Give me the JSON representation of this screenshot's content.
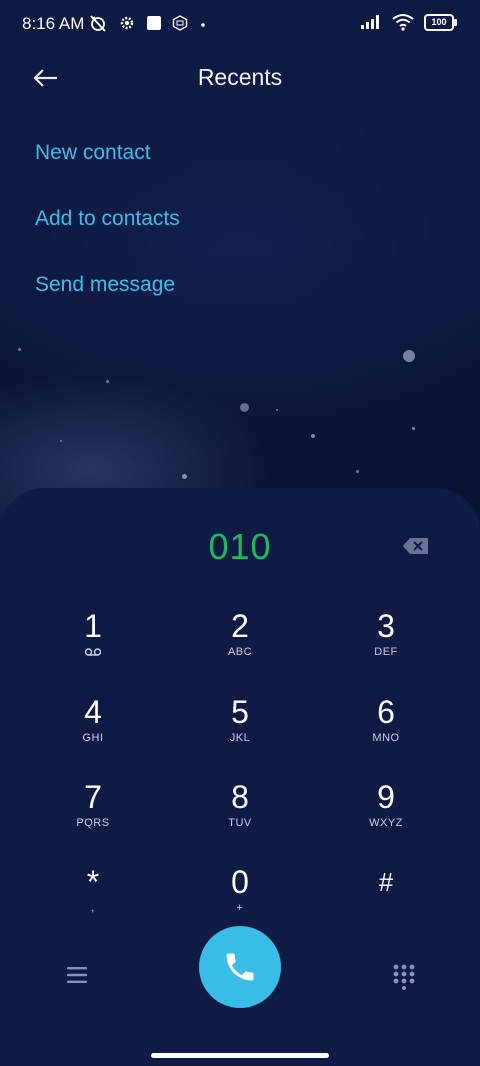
{
  "status_bar": {
    "time": "8:16 AM",
    "battery": "100",
    "icons": [
      "alarm-off-icon",
      "gear-icon",
      "square-icon",
      "mi-icon",
      "dot-icon",
      "signal-icon",
      "wifi-icon",
      "battery-icon"
    ]
  },
  "header": {
    "title": "Recents",
    "back_icon": "back-arrow-icon"
  },
  "menu": {
    "new_contact": "New contact",
    "add_to_contacts": "Add to contacts",
    "send_message": "Send message"
  },
  "dialer": {
    "number": "010",
    "keys": [
      {
        "digit": "1",
        "letters": ""
      },
      {
        "digit": "2",
        "letters": "ABC"
      },
      {
        "digit": "3",
        "letters": "DEF"
      },
      {
        "digit": "4",
        "letters": "GHI"
      },
      {
        "digit": "5",
        "letters": "JKL"
      },
      {
        "digit": "6",
        "letters": "MNO"
      },
      {
        "digit": "7",
        "letters": "PQRS"
      },
      {
        "digit": "8",
        "letters": "TUV"
      },
      {
        "digit": "9",
        "letters": "WXYZ"
      },
      {
        "digit": "*",
        "letters": ","
      },
      {
        "digit": "0",
        "letters": "+"
      },
      {
        "digit": "#",
        "letters": ""
      }
    ]
  },
  "colors": {
    "accent": "#3dbde8",
    "number": "#1fb85f",
    "call_button": "#37bde6",
    "background": "#0b1437",
    "panel": "#0f1a45"
  }
}
